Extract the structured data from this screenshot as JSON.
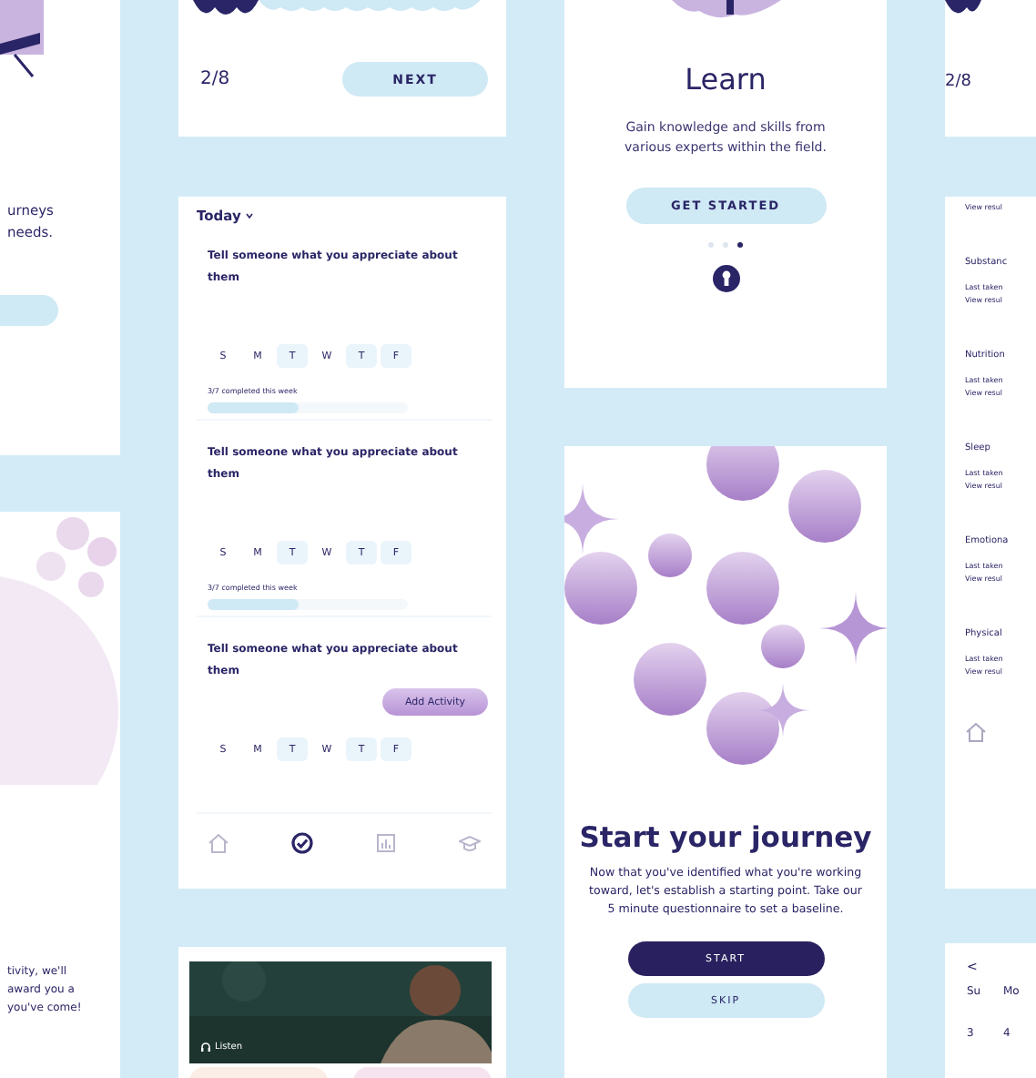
{
  "left_column": {
    "intro_lines": [
      "urneys",
      "needs."
    ],
    "reward_lines": [
      "tivity, we'll",
      "award you a",
      "you've come!"
    ]
  },
  "progress_card": {
    "step": "2/8",
    "button": "NEXT"
  },
  "today": {
    "title": "Today",
    "activities": [
      {
        "title": "Tell someone what you appreciate about them",
        "days": [
          {
            "label": "S",
            "done": false
          },
          {
            "label": "M",
            "done": false
          },
          {
            "label": "T",
            "done": true
          },
          {
            "label": "W",
            "done": false
          },
          {
            "label": "T",
            "done": true
          },
          {
            "label": "F",
            "done": true
          }
        ],
        "progress_text": "3/7 completed this week",
        "level": 0.45
      },
      {
        "title": "Tell someone what you appreciate about them",
        "days": [
          {
            "label": "S",
            "done": false
          },
          {
            "label": "M",
            "done": false
          },
          {
            "label": "T",
            "done": true
          },
          {
            "label": "W",
            "done": false
          },
          {
            "label": "T",
            "done": true
          },
          {
            "label": "F",
            "done": true
          }
        ],
        "progress_text": "3/7 completed this week",
        "level": 0.45
      },
      {
        "title": "Tell someone what you appreciate about them",
        "days": [
          {
            "label": "S",
            "done": false
          },
          {
            "label": "M",
            "done": false
          },
          {
            "label": "T",
            "done": true
          },
          {
            "label": "W",
            "done": false
          },
          {
            "label": "T",
            "done": true
          },
          {
            "label": "F",
            "done": true
          }
        ],
        "action": "Add Activity"
      }
    ],
    "nav": [
      {
        "kind": "home",
        "selected": false
      },
      {
        "kind": "check",
        "selected": true
      },
      {
        "kind": "chart",
        "selected": false
      },
      {
        "kind": "learn",
        "selected": false
      }
    ]
  },
  "listen_card": {
    "label": "Listen"
  },
  "learn": {
    "title": "Learn",
    "text": "Gain knowledge and skills from various experts within the field.",
    "button": "GET STARTED",
    "pages": [
      {
        "selected": false
      },
      {
        "selected": false
      },
      {
        "selected": true
      }
    ]
  },
  "journey": {
    "title": "Start your journey",
    "text": "Now that you've identified what you're working toward, let's establish a starting point. Take our 5 minute questionnaire to set a baseline.",
    "buttons": [
      {
        "label": "START",
        "kind": "primary"
      },
      {
        "label": "SKIP",
        "kind": "secondary"
      }
    ]
  },
  "right_progress": {
    "step": "2/8"
  },
  "assessments": {
    "top_link": "View resul",
    "items": [
      {
        "title": "Substanc",
        "meta": "Last taken",
        "link": "View resul"
      },
      {
        "title": "Nutrition",
        "meta": "Last taken",
        "link": "View resul"
      },
      {
        "title": "Sleep",
        "meta": "Last taken",
        "link": "View resul"
      },
      {
        "title": "Emotiona",
        "meta": "Last taken",
        "link": "View resul"
      },
      {
        "title": "Physical",
        "meta": "Last taken",
        "link": "View resul"
      }
    ]
  },
  "calendar": {
    "back": "<",
    "weekdays": [
      "Su",
      "Mo"
    ],
    "dates": [
      "3",
      "4"
    ]
  }
}
